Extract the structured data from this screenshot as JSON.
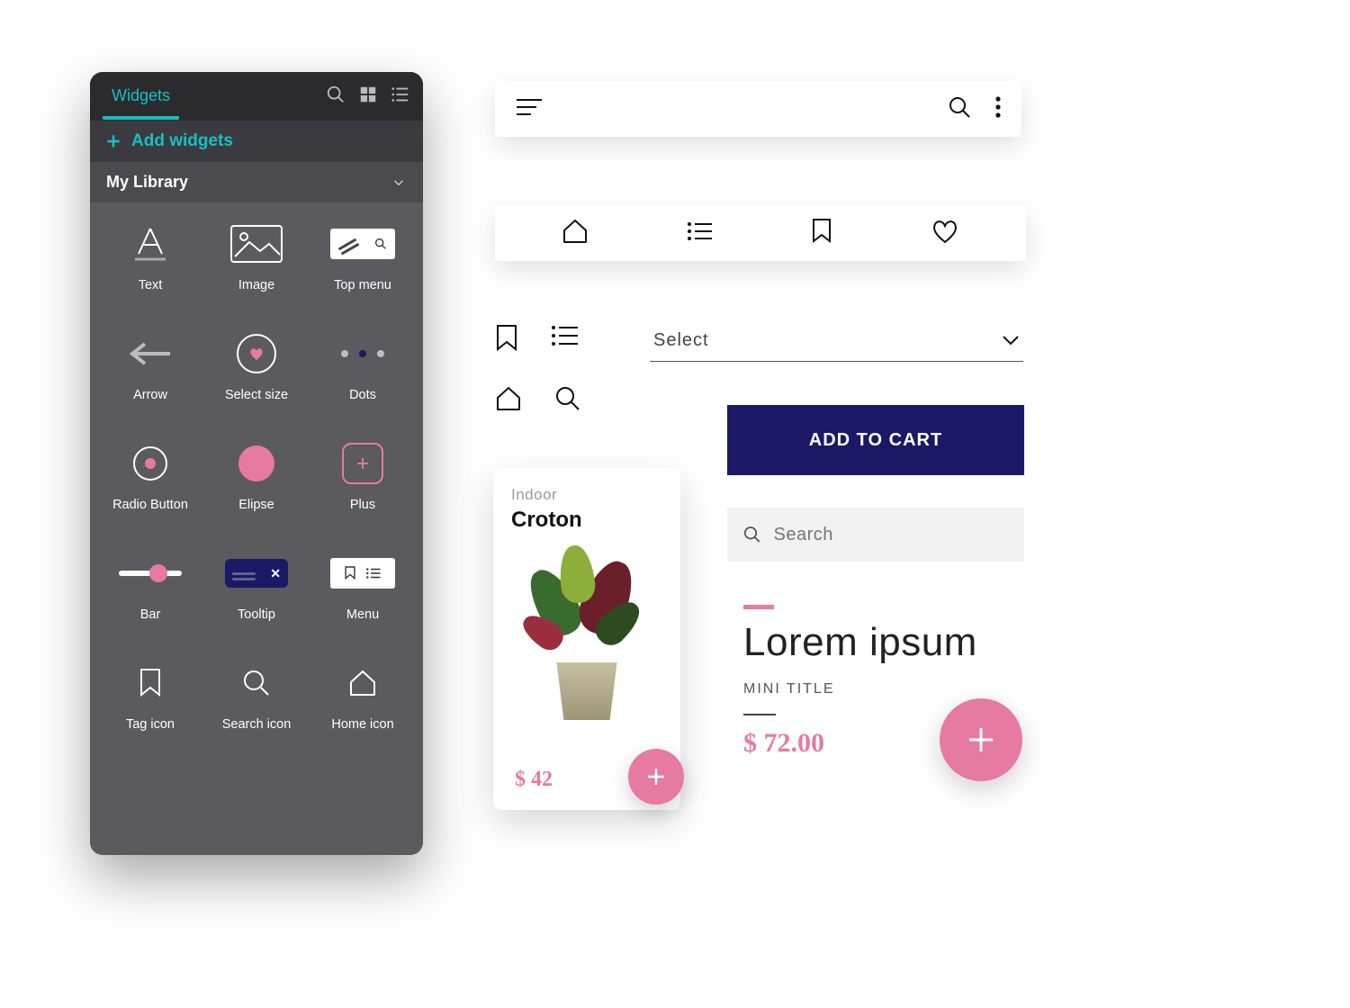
{
  "panel": {
    "tab": "Widgets",
    "add": "Add widgets",
    "section": "My Library",
    "items": {
      "text": "Text",
      "image": "Image",
      "topmenu": "Top menu",
      "arrow": "Arrow",
      "selectsize": "Select size",
      "dots": "Dots",
      "radio": "Radio Button",
      "elipse": "Elipse",
      "plus": "Plus",
      "bar": "Bar",
      "tooltip": "Tooltip",
      "menu": "Menu",
      "tag": "Tag icon",
      "search": "Search icon",
      "home": "Home icon"
    }
  },
  "select": {
    "label": "Select"
  },
  "cart": {
    "label": "ADD TO CART"
  },
  "search": {
    "placeholder": "Search"
  },
  "title": {
    "heading": "Lorem ipsum",
    "mini": "MINI TITLE",
    "price": "$ 72.00"
  },
  "product": {
    "subtitle": "Indoor",
    "name": "Croton",
    "price": "$ 42"
  },
  "colors": {
    "teal": "#14c1c0",
    "navy": "#1a1966",
    "pink": "#e77aa1"
  }
}
